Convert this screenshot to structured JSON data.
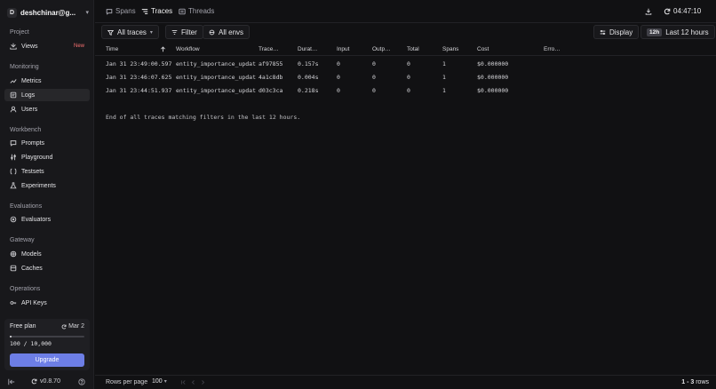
{
  "org": {
    "initial": "D",
    "name": "deshchinar@g..."
  },
  "sidebar": {
    "sections": [
      {
        "title": "Project",
        "items": [
          {
            "label": "Views",
            "icon": "views-icon",
            "badge": "New"
          }
        ]
      },
      {
        "title": "Monitoring",
        "items": [
          {
            "label": "Metrics",
            "icon": "chart-line-icon"
          },
          {
            "label": "Logs",
            "icon": "logs-icon",
            "active": true
          },
          {
            "label": "Users",
            "icon": "user-icon"
          }
        ]
      },
      {
        "title": "Workbench",
        "items": [
          {
            "label": "Prompts",
            "icon": "message-icon"
          },
          {
            "label": "Playground",
            "icon": "sliders-icon"
          },
          {
            "label": "Testsets",
            "icon": "testset-icon"
          },
          {
            "label": "Experiments",
            "icon": "flask-icon"
          }
        ]
      },
      {
        "title": "Evaluations",
        "items": [
          {
            "label": "Evaluators",
            "icon": "evaluator-icon"
          }
        ]
      },
      {
        "title": "Gateway",
        "items": [
          {
            "label": "Models",
            "icon": "model-icon"
          },
          {
            "label": "Caches",
            "icon": "cache-icon"
          }
        ]
      },
      {
        "title": "Operations",
        "items": [
          {
            "label": "API Keys",
            "icon": "key-icon"
          }
        ]
      }
    ]
  },
  "plan": {
    "name": "Free plan",
    "renew": "Mar 2",
    "usage": "100 / 10,000",
    "progress": 0.01,
    "upgrade_label": "Upgrade"
  },
  "footer": {
    "version": "v0.8.70"
  },
  "header": {
    "tabs": [
      {
        "label": "Spans",
        "icon": "spans-icon"
      },
      {
        "label": "Traces",
        "icon": "traces-icon",
        "active": true
      },
      {
        "label": "Threads",
        "icon": "threads-icon"
      }
    ],
    "clock": "04:47:10"
  },
  "toolbar": {
    "all_traces": "All traces",
    "filter": "Filter",
    "all_envs": "All envs",
    "display": "Display",
    "time_chip": "12h",
    "time_range": "Last 12 hours"
  },
  "table": {
    "columns": [
      "Time",
      "Workflow",
      "Trace…",
      "Durat…",
      "Input",
      "Outp…",
      "Total",
      "Spans",
      "Cost",
      "Erro…"
    ],
    "rows": [
      [
        "Jan 31 23:49:00.597",
        "entity_importance_update.t",
        "af97855",
        "0.157s",
        "0",
        "0",
        "0",
        "1",
        "$0.000000",
        ""
      ],
      [
        "Jan 31 23:46:07.625",
        "entity_importance_update.t",
        "4a1c8db",
        "0.004s",
        "0",
        "0",
        "0",
        "1",
        "$0.000000",
        ""
      ],
      [
        "Jan 31 23:44:51.937",
        "entity_importance_update.t",
        "d03c3ca",
        "0.218s",
        "0",
        "0",
        "0",
        "1",
        "$0.000000",
        ""
      ]
    ],
    "end_note": "End of all traces matching filters in the last 12 hours."
  },
  "pager": {
    "rows_per_page_label": "Rows per page",
    "rows_per_page": "100",
    "range": "1 - 3",
    "suffix": "rows"
  }
}
